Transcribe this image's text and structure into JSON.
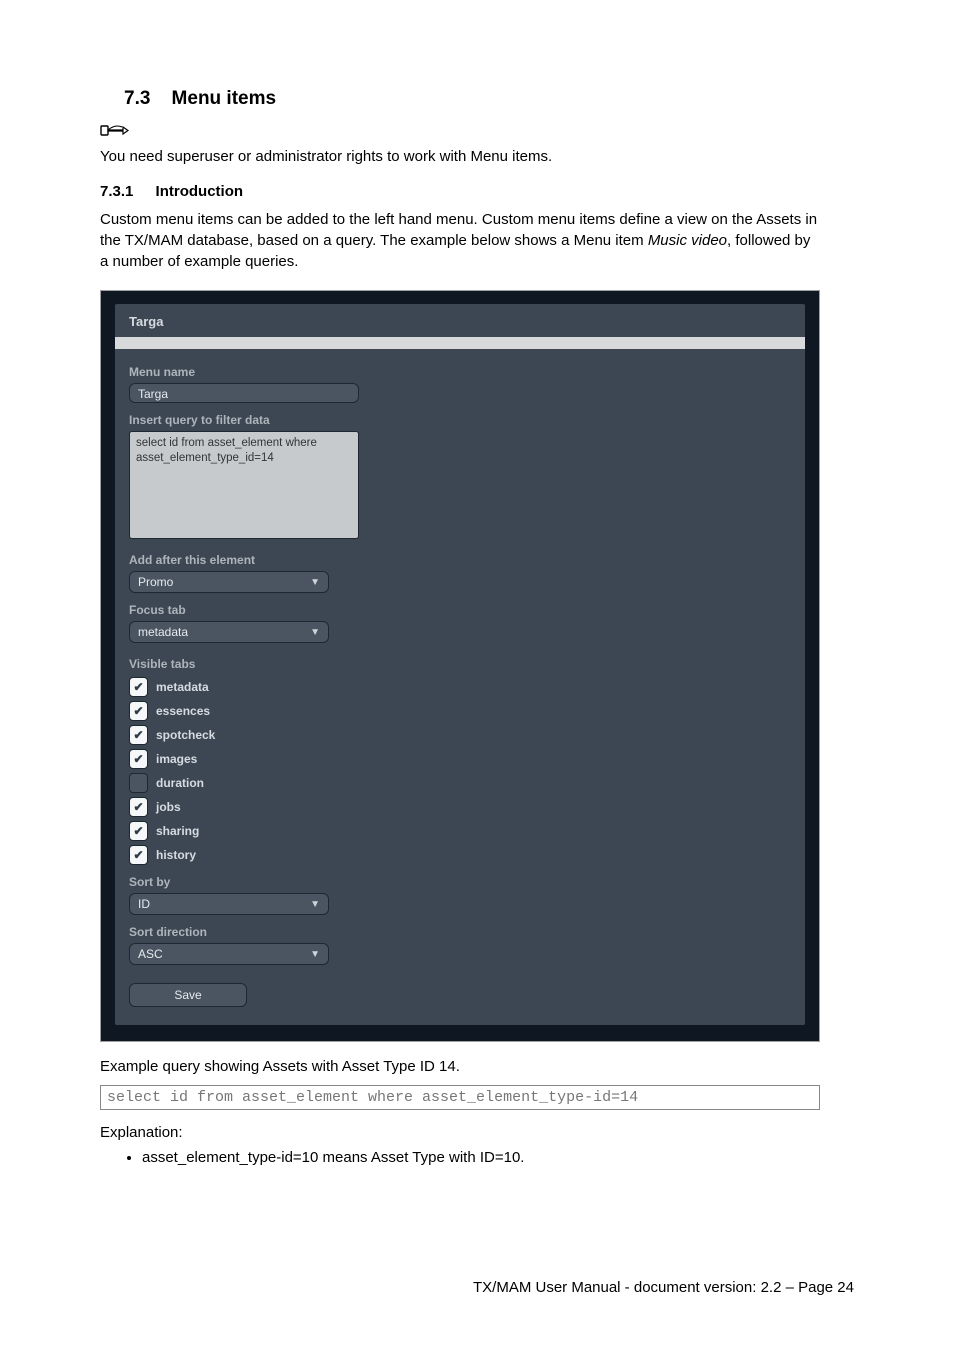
{
  "section": {
    "number": "7.3",
    "title": "Menu items"
  },
  "note_text": "You need superuser or administrator rights to work with Menu items.",
  "subsection": {
    "number": "7.3.1",
    "title": "Introduction"
  },
  "intro": {
    "p1a": "Custom menu items can be added to the left hand menu. Custom menu items define a view on the Assets in the TX/MAM database, based on a query. The example below shows a Menu item ",
    "p1_italic": "Music video",
    "p1b": ", followed by a number of example queries."
  },
  "figure": {
    "window_title": "Targa",
    "labels": {
      "menu_name": "Menu name",
      "insert_query": "Insert query to filter data",
      "add_after": "Add after this element",
      "focus_tab": "Focus tab",
      "visible_tabs": "Visible tabs",
      "sort_by": "Sort by",
      "sort_direction": "Sort direction"
    },
    "menu_name_value": "Targa",
    "query_text": "select id from asset_element where asset_element_type_id=14",
    "add_after_value": "Promo",
    "focus_tab_value": "metadata",
    "visible_tabs": [
      {
        "label": "metadata",
        "checked": true
      },
      {
        "label": "essences",
        "checked": true
      },
      {
        "label": "spotcheck",
        "checked": true
      },
      {
        "label": "images",
        "checked": true
      },
      {
        "label": "duration",
        "checked": false
      },
      {
        "label": "jobs",
        "checked": true
      },
      {
        "label": "sharing",
        "checked": true
      },
      {
        "label": "history",
        "checked": true
      }
    ],
    "sort_by_value": "ID",
    "sort_direction_value": "ASC",
    "save_button": "Save"
  },
  "example_caption": "Example query showing Assets with Asset Type ID 14.",
  "example_code": "select id from asset_element where asset_element_type-id=14",
  "explanation_label": "Explanation:",
  "bullets": [
    "asset_element_type-id=10 means Asset Type with ID=10."
  ],
  "footer": "TX/MAM User Manual - document version: 2.2 – Page 24"
}
